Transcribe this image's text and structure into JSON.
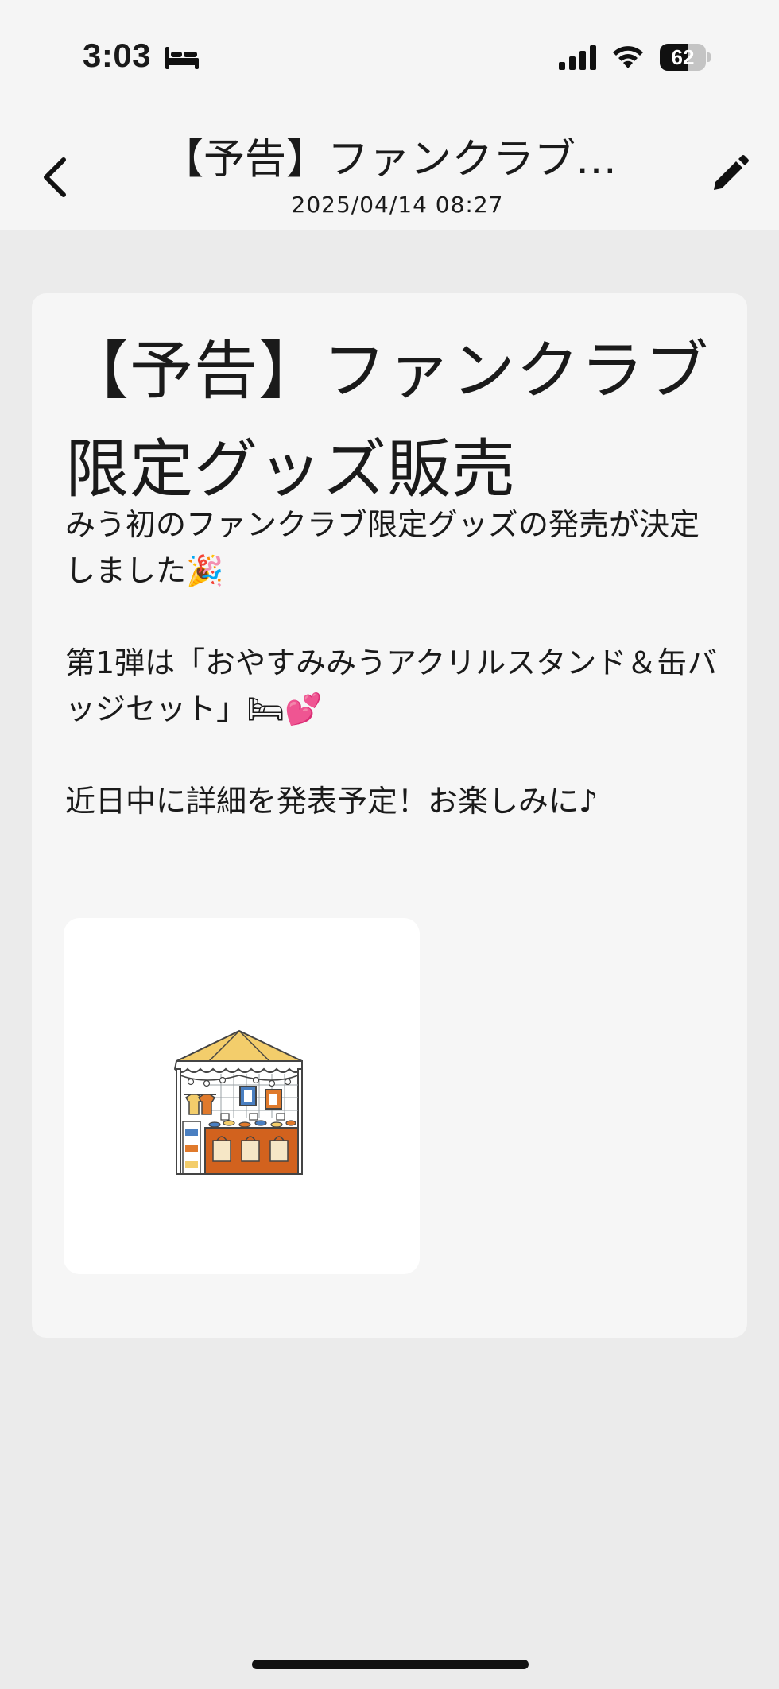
{
  "status_bar": {
    "time": "3:03",
    "battery_level": "62",
    "battery_fraction": 0.62
  },
  "nav": {
    "title": "【予告】ファンクラブ…",
    "date": "2025/04/14 08:27"
  },
  "post": {
    "title": "【予告】ファンクラブ限定グッズ販売",
    "body": "みう初のファンクラブ限定グッズの発売が決定しました🎉\n\n第1弾は「おやすみみうアクリルスタンド＆缶バッジセット」🛏💕\n\n近日中に詳細を発表予定！お楽しみに♪",
    "image_icon": "merch-booth-icon"
  },
  "icons": {
    "back": "chevron-left-icon",
    "edit": "pencil-icon",
    "bed": "bed-icon",
    "signal": "cellular-signal-icon",
    "wifi": "wifi-icon"
  }
}
